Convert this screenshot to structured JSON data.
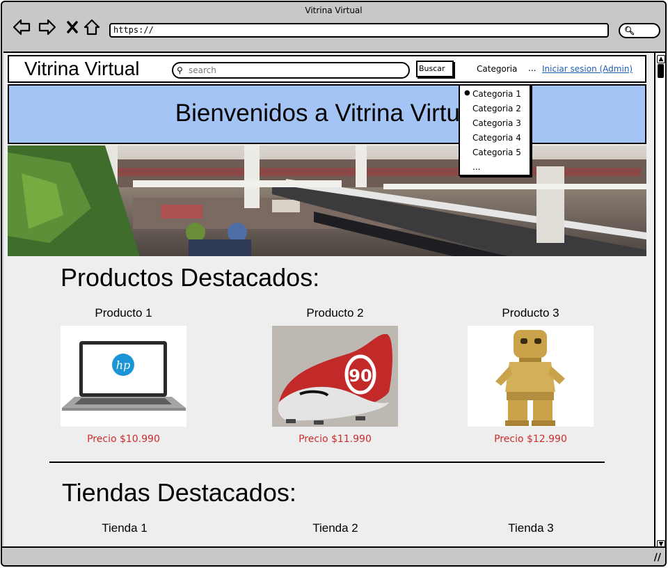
{
  "window": {
    "title": "Vitrina Virtual"
  },
  "browser": {
    "url": "https://"
  },
  "nav": {
    "brand": "Vitrina Virtual",
    "search_placeholder": "search",
    "search_button": "Buscar",
    "category_label": "Categoria",
    "more": "...",
    "login_link": "Iniciar sesion (Admin)"
  },
  "category_menu": {
    "items": [
      "Categoria 1",
      "Categoria 2",
      "Categoria 3",
      "Categoria 4",
      "Categoria 5",
      "..."
    ]
  },
  "banner": {
    "title": "Bienvenidos a Vitrina Virtual"
  },
  "featured_products": {
    "heading": "Productos Destacados:",
    "items": [
      {
        "name": "Producto 1",
        "price": "Precio $10.990"
      },
      {
        "name": "Producto 2",
        "price": "Precio $11.990"
      },
      {
        "name": "Producto 3",
        "price": "Precio $12.990"
      }
    ]
  },
  "featured_stores": {
    "heading": "Tiendas Destacados:",
    "items": [
      "Tienda 1",
      "Tienda 2",
      "Tienda 3"
    ]
  },
  "colors": {
    "banner_bg": "#a3c4f5",
    "price": "#d02b2b",
    "link": "#1f5fb0",
    "page_bg": "#eeeeee"
  }
}
